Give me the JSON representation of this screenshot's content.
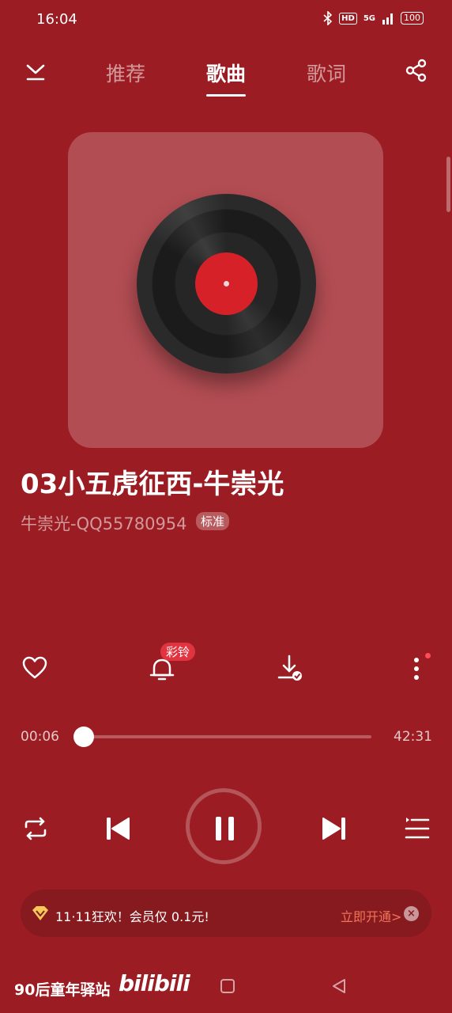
{
  "status_bar": {
    "time": "16:04",
    "hd": "HD",
    "network": "5G",
    "battery": "100"
  },
  "tabs": [
    {
      "label": "推荐",
      "active": false
    },
    {
      "label": "歌曲",
      "active": true
    },
    {
      "label": "歌词",
      "active": false
    }
  ],
  "song": {
    "title": "03小五虎征西-牛崇光",
    "artist": "牛崇光-QQ55780954",
    "quality": "标准"
  },
  "actions": {
    "ringtone_badge": "彩铃"
  },
  "progress": {
    "current": "00:06",
    "total": "42:31",
    "fraction": 0.0
  },
  "promo": {
    "text": "11·11狂欢！会员仅 0.1元!",
    "cta": "立即开通>",
    "close": "×"
  },
  "watermark": {
    "text": "90后童年驿站",
    "logo": "bilibili"
  },
  "colors": {
    "background": "#9b1c22",
    "accent": "#e23440",
    "promo_cta": "#f0745a"
  }
}
